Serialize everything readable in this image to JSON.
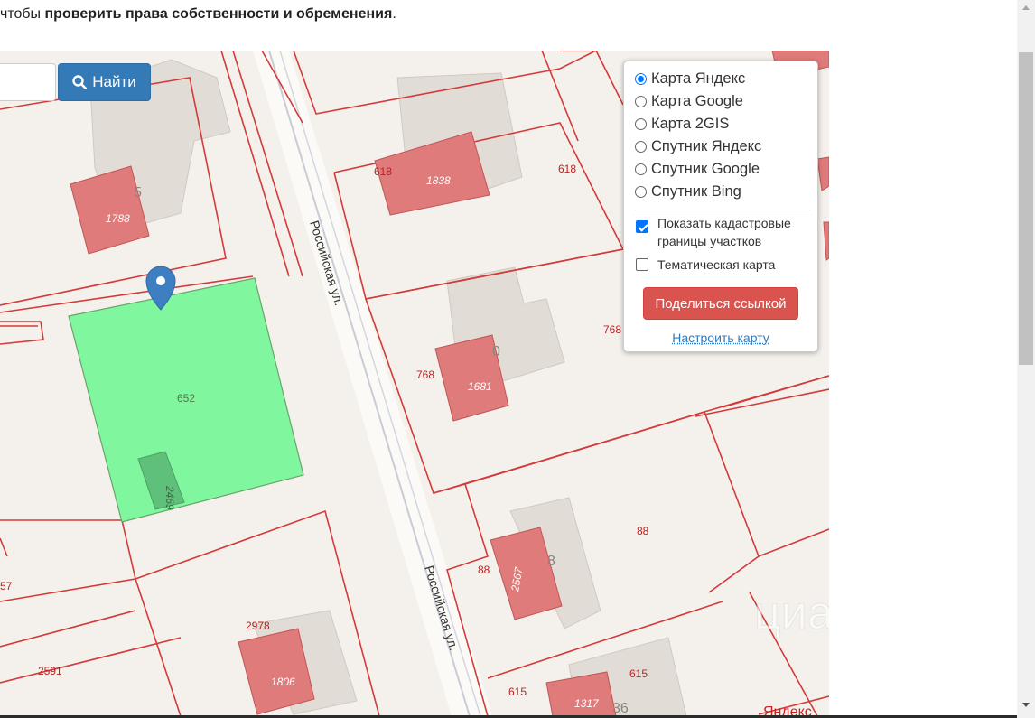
{
  "intro": {
    "prefix": "чтобы ",
    "bold": "проверить права собственности и обременения",
    "suffix": "."
  },
  "search": {
    "button_label": "Найти",
    "input_value": "",
    "icon": "search-icon"
  },
  "map": {
    "marker_icon": "map-pin-icon",
    "street_names": [
      "Российская ул.",
      "Российская ул."
    ],
    "parcel_labels": [
      "618",
      "618",
      "768",
      "768",
      "652",
      "88",
      "88",
      "615",
      "615",
      "2978",
      "2591",
      "57"
    ],
    "building_labels": [
      "1838",
      "1788",
      "1681",
      "2469",
      "2567",
      "1806",
      "1317"
    ],
    "house_numbers": [
      "5",
      "0",
      "8",
      "36"
    ],
    "watermark": "циан",
    "provider_mark": "Яндекс",
    "colors": {
      "parcel_border": "#d33a3a",
      "building_fill": "#e07b7b",
      "selected_parcel": "#80f79e",
      "marker": "#3d7fc1"
    }
  },
  "layers_panel": {
    "options": [
      {
        "label": "Карта Яндекс",
        "selected": true
      },
      {
        "label": "Карта Google",
        "selected": false
      },
      {
        "label": "Карта 2GIS",
        "selected": false
      },
      {
        "label": "Спутник Яндекс",
        "selected": false
      },
      {
        "label": "Спутник Google",
        "selected": false
      },
      {
        "label": "Спутник Bing",
        "selected": false
      }
    ],
    "checkboxes": [
      {
        "label": "Показать кадастровые границы участков",
        "checked": true
      },
      {
        "label": "Тематическая карта",
        "checked": false
      }
    ],
    "share_button": "Поделиться ссылкой",
    "setup_link": "Настроить карту"
  }
}
